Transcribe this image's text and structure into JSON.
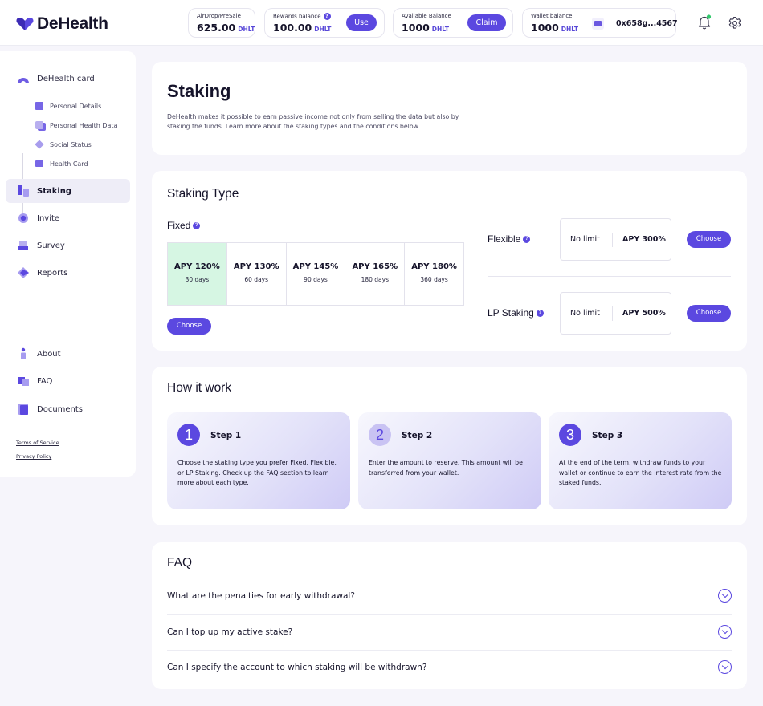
{
  "app": {
    "name": "DeHealth"
  },
  "header": {
    "airdrop": {
      "label": "AirDrop/PreSale",
      "value": "625.00",
      "unit": "DHLT"
    },
    "rewards": {
      "label": "Rewards balance",
      "value": "100.00",
      "unit": "DHLT",
      "button": "Use"
    },
    "available": {
      "label": "Available Balance",
      "value": "1000",
      "unit": "DHLT",
      "button": "Claim"
    },
    "wallet": {
      "label": "Wallet balance",
      "value": "1000",
      "unit": "DHLT",
      "address": "0x658g...4567"
    },
    "notification_dot_color": "#31c86b"
  },
  "sidebar": {
    "card_title": "DeHealth card",
    "card_items": [
      {
        "label": "Personal Details",
        "icon": "document-icon"
      },
      {
        "label": "Personal Health Data",
        "icon": "health-data-icon"
      },
      {
        "label": "Social Status",
        "icon": "social-icon"
      },
      {
        "label": "Health Card",
        "icon": "card-icon"
      }
    ],
    "items": [
      {
        "label": "Staking",
        "icon": "staking-icon",
        "active": true
      },
      {
        "label": "Invite",
        "icon": "invite-icon"
      },
      {
        "label": "Survey",
        "icon": "survey-icon"
      },
      {
        "label": "Reports",
        "icon": "reports-icon"
      }
    ],
    "bottom_items": [
      {
        "label": "About",
        "icon": "about-icon"
      },
      {
        "label": "FAQ",
        "icon": "faq-icon"
      },
      {
        "label": "Documents",
        "icon": "documents-icon"
      }
    ],
    "terms": "Terms of Service",
    "privacy": "Privacy Policy"
  },
  "staking": {
    "title": "Staking",
    "description": "DeHealth makes it possible to earn passive income not only from selling the data but also by staking the funds. Learn more about the staking types and the conditions below."
  },
  "staking_type": {
    "title": "Staking Type",
    "fixed": {
      "label": "Fixed",
      "periods": [
        {
          "apy": "APY 120%",
          "days": "30 days",
          "selected": true
        },
        {
          "apy": "APY 130%",
          "days": "60 days"
        },
        {
          "apy": "APY 145%",
          "days": "90 days"
        },
        {
          "apy": "APY 165%",
          "days": "180 days"
        },
        {
          "apy": "APY 180%",
          "days": "360 days"
        }
      ],
      "choose": "Choose"
    },
    "flexible": {
      "label": "Flexible",
      "limit": "No limit",
      "apy": "APY 300%",
      "choose": "Choose"
    },
    "lp": {
      "label": "LP Staking",
      "limit": "No limit",
      "apy": "APY 500%",
      "choose": "Choose"
    }
  },
  "how": {
    "title": "How it work",
    "steps": [
      {
        "num": "1",
        "title": "Step 1",
        "text": "Choose the staking type you prefer Fixed, Flexible, or LP Staking. Check up the FAQ section to learn more about each type."
      },
      {
        "num": "2",
        "title": "Step 2",
        "text": "Enter the amount to reserve. This amount will be transferred from your wallet."
      },
      {
        "num": "3",
        "title": "Step 3",
        "text": "At the end of the term, withdraw funds to your wallet or continue to earn the interest rate from the staked funds."
      }
    ]
  },
  "faq": {
    "title": "FAQ",
    "questions": [
      "What are the penalties for early withdrawal?",
      "Can I top up my active stake?",
      "Can I specify the account to which staking will be withdrawn?"
    ]
  },
  "colors": {
    "accent": "#5b48e0",
    "selected_period": "#d6f6e3"
  }
}
